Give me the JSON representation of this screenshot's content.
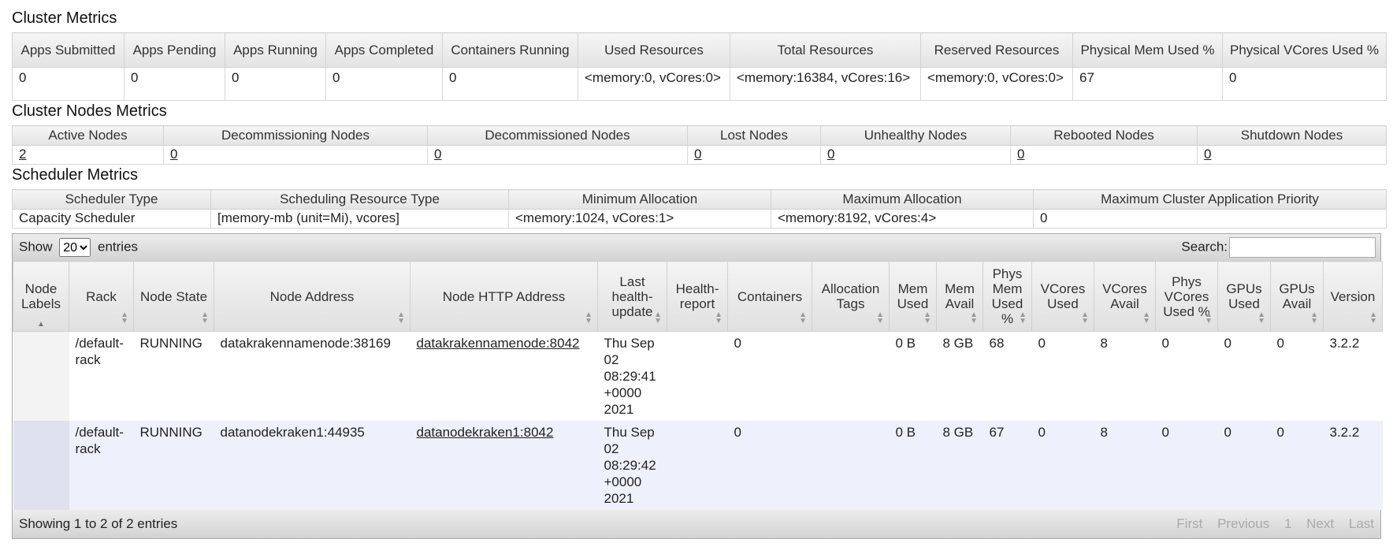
{
  "cluster_metrics": {
    "title": "Cluster Metrics",
    "headers": [
      "Apps Submitted",
      "Apps Pending",
      "Apps Running",
      "Apps Completed",
      "Containers Running",
      "Used Resources",
      "Total Resources",
      "Reserved Resources",
      "Physical Mem Used %",
      "Physical VCores Used %"
    ],
    "values": [
      "0",
      "0",
      "0",
      "0",
      "0",
      "<memory:0, vCores:0>",
      "<memory:16384, vCores:16>",
      "<memory:0, vCores:0>",
      "67",
      "0"
    ]
  },
  "node_metrics": {
    "title": "Cluster Nodes Metrics",
    "headers": [
      "Active Nodes",
      "Decommissioning Nodes",
      "Decommissioned Nodes",
      "Lost Nodes",
      "Unhealthy Nodes",
      "Rebooted Nodes",
      "Shutdown Nodes"
    ],
    "values": [
      "2",
      "0",
      "0",
      "0",
      "0",
      "0",
      "0"
    ]
  },
  "scheduler_metrics": {
    "title": "Scheduler Metrics",
    "headers": [
      "Scheduler Type",
      "Scheduling Resource Type",
      "Minimum Allocation",
      "Maximum Allocation",
      "Maximum Cluster Application Priority"
    ],
    "values": [
      "Capacity Scheduler",
      "[memory-mb (unit=Mi), vcores]",
      "<memory:1024, vCores:1>",
      "<memory:8192, vCores:4>",
      "0"
    ]
  },
  "nodes_table": {
    "show_label": "Show",
    "entries_label": "entries",
    "page_size": "20",
    "search_label": "Search:",
    "search_value": "",
    "headers": [
      "Node Labels",
      "Rack",
      "Node State",
      "Node Address",
      "Node HTTP Address",
      "Last health-update",
      "Health-report",
      "Containers",
      "Allocation Tags",
      "Mem Used",
      "Mem Avail",
      "Phys Mem Used %",
      "VCores Used",
      "VCores Avail",
      "Phys VCores Used %",
      "GPUs Used",
      "GPUs Avail",
      "Version"
    ],
    "rows": [
      [
        "",
        "/default-rack",
        "RUNNING",
        "datakrakennamenode:38169",
        "datakrakennamenode:8042",
        "Thu Sep 02 08:29:41 +0000 2021",
        "",
        "0",
        "",
        "0 B",
        "8 GB",
        "68",
        "0",
        "8",
        "0",
        "0",
        "0",
        "3.2.2"
      ],
      [
        "",
        "/default-rack",
        "RUNNING",
        "datanodekraken1:44935",
        "datanodekraken1:8042",
        "Thu Sep 02 08:29:42 +0000 2021",
        "",
        "0",
        "",
        "0 B",
        "8 GB",
        "67",
        "0",
        "8",
        "0",
        "0",
        "0",
        "3.2.2"
      ]
    ],
    "info": "Showing 1 to 2 of 2 entries",
    "pager": {
      "first": "First",
      "previous": "Previous",
      "page": "1",
      "next": "Next",
      "last": "Last"
    }
  }
}
